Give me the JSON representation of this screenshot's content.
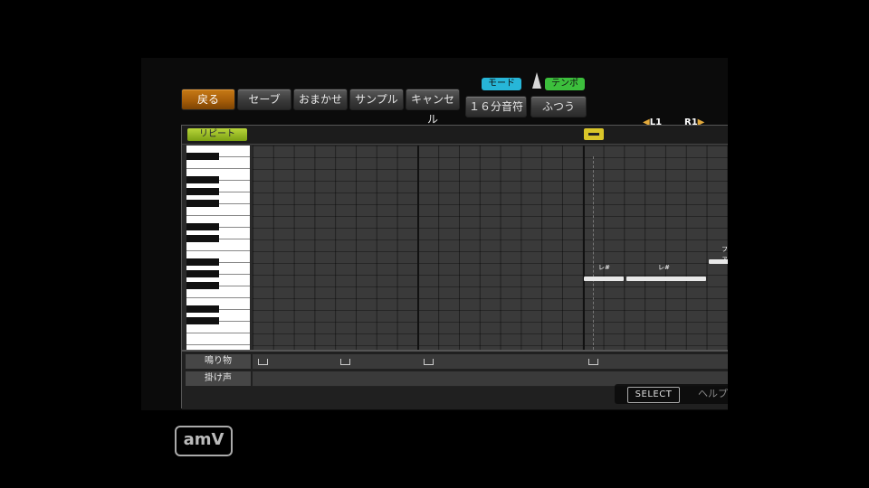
{
  "toolbar": {
    "back": "戻る",
    "save": "セーブ",
    "auto": "おまかせ",
    "sample": "サンプル",
    "cancel": "キャンセル",
    "mode_tag": "モード",
    "tempo_tag": "テンポ",
    "note_value": "１６分音符",
    "tempo_value": "ふつう"
  },
  "navigation": {
    "left": "L1",
    "right": "R1"
  },
  "editor": {
    "repeat_label": "リピート",
    "notes": [
      {
        "label": "レ#"
      },
      {
        "label": "レ#"
      },
      {
        "label": "ファ"
      }
    ]
  },
  "select_bar": {
    "select": "SELECT",
    "help": "ヘルプ"
  },
  "tracks": [
    {
      "name": "鳴り物"
    },
    {
      "name": "掛け声"
    }
  ],
  "watermark": "amV",
  "colors": {
    "active_button": "#a35b08",
    "mode_tag": "#27b6d8",
    "tempo_tag": "#3cbf3c",
    "repeat": "#9cc122",
    "marker": "#d9c529"
  }
}
